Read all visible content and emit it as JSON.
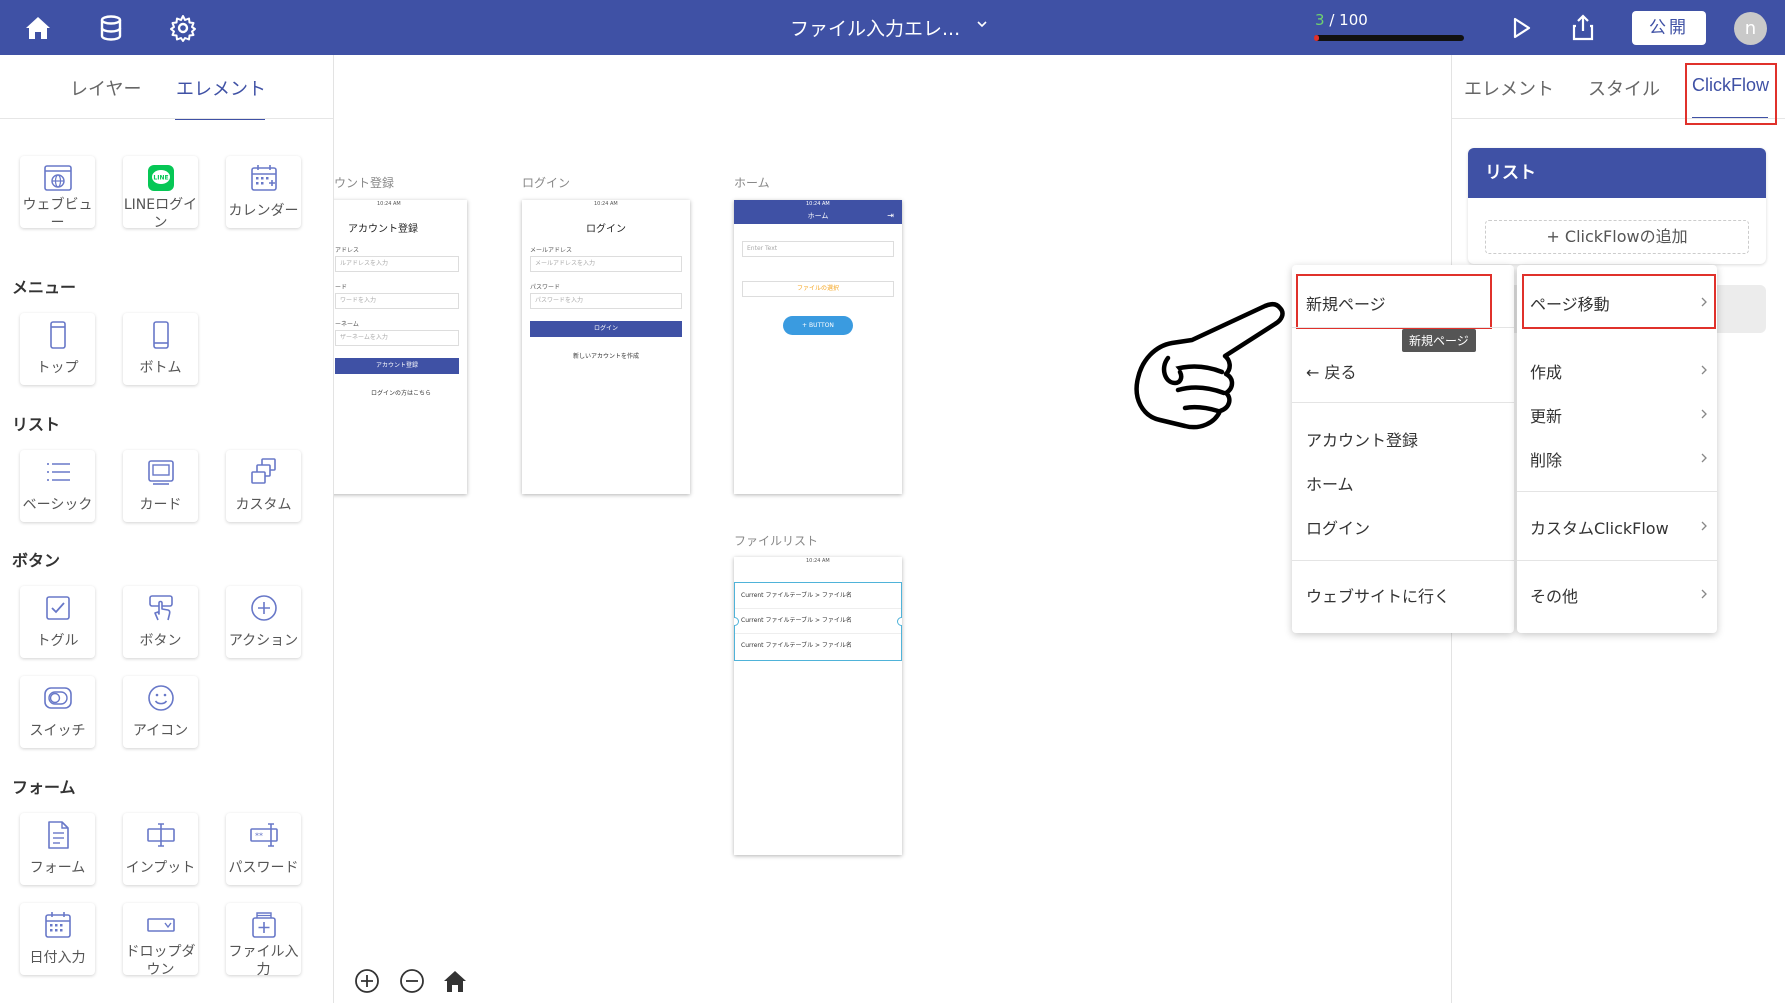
{
  "topbar": {
    "title": "ファイル入力エレ...",
    "progress_current": "3",
    "progress_total": "/ 100",
    "progress_fraction": 0.03,
    "publish_label": "公開",
    "avatar_letter": "n",
    "colors": {
      "bar": "#3f51a5",
      "progress": "#e0312b"
    }
  },
  "left_panel": {
    "tabs": [
      "レイヤー",
      "エレメント"
    ],
    "active_tab": "エレメント",
    "top_items": [
      {
        "label": "ウェブビュー",
        "icon": "webview-icon"
      },
      {
        "label": "LINEログイン",
        "icon": "line-icon"
      },
      {
        "label": "カレンダー",
        "icon": "calendar-icon"
      }
    ],
    "sections": [
      {
        "title": "メニュー",
        "items": [
          {
            "label": "トップ",
            "icon": "phone-top-icon"
          },
          {
            "label": "ボトム",
            "icon": "phone-bottom-icon"
          }
        ]
      },
      {
        "title": "リスト",
        "items": [
          {
            "label": "ベーシック",
            "icon": "list-basic-icon"
          },
          {
            "label": "カード",
            "icon": "card-icon"
          },
          {
            "label": "カスタム",
            "icon": "custom-list-icon"
          }
        ]
      },
      {
        "title": "ボタン",
        "items": [
          {
            "label": "トグル",
            "icon": "toggle-check-icon"
          },
          {
            "label": "ボタン",
            "icon": "button-tap-icon"
          },
          {
            "label": "アクション",
            "icon": "action-plus-icon"
          },
          {
            "label": "スイッチ",
            "icon": "switch-icon"
          },
          {
            "label": "アイコン",
            "icon": "smiley-icon"
          }
        ]
      },
      {
        "title": "フォーム",
        "items": [
          {
            "label": "フォーム",
            "icon": "form-icon"
          },
          {
            "label": "インプット",
            "icon": "input-icon"
          },
          {
            "label": "パスワード",
            "icon": "password-icon"
          },
          {
            "label": "日付入力",
            "icon": "date-input-icon"
          },
          {
            "label": "ドロップダウン",
            "icon": "dropdown-icon"
          },
          {
            "label": "ファイル入力",
            "icon": "file-input-icon"
          }
        ]
      }
    ]
  },
  "canvas": {
    "screens": [
      {
        "label": "ウント登録",
        "title": "アカウント登録",
        "status": "10:24 AM",
        "fields": [
          {
            "label": "アドレス",
            "placeholder": "ルアドレスを入力"
          },
          {
            "label": "ード",
            "placeholder": "ワードを入力"
          },
          {
            "label": "ーネーム",
            "placeholder": "ザーネームを入力"
          }
        ],
        "button": "アカウント登録",
        "link": "ログインの方はこちら"
      },
      {
        "label": "ログイン",
        "title": "ログイン",
        "status": "10:24 AM",
        "fields": [
          {
            "label": "メールアドレス",
            "placeholder": "メールアドレスを入力"
          },
          {
            "label": "パスワード",
            "placeholder": "パスワードを入力"
          }
        ],
        "button": "ログイン",
        "link": "新しいアカウントを作成"
      },
      {
        "label": "ホーム",
        "header": "ホーム",
        "status": "10:24 AM",
        "input_placeholder": "Enter Text",
        "file_select": "ファイルの選択",
        "button": "+ BUTTON"
      },
      {
        "label": "ファイルリスト",
        "status": "10:24 AM",
        "rows": [
          "Current ファイルテーブル > ファイル名",
          "Current ファイルテーブル > ファイル名",
          "Current ファイルテーブル > ファイル名"
        ]
      }
    ]
  },
  "right_panel": {
    "tabs": [
      "エレメント",
      "スタイル",
      "ClickFlow"
    ],
    "active_tab": "ClickFlow",
    "list_header": "リスト",
    "add_clickflow": "+ ClickFlowの追加"
  },
  "menu_left": {
    "items": [
      "新規ページ",
      "← 戻る",
      "アカウント登録",
      "ホーム",
      "ログイン",
      "ウェブサイトに行く"
    ],
    "tooltip": "新規ページ"
  },
  "menu_right": {
    "items": [
      "ページ移動",
      "作成",
      "更新",
      "削除",
      "カスタムClickFlow",
      "その他"
    ]
  }
}
